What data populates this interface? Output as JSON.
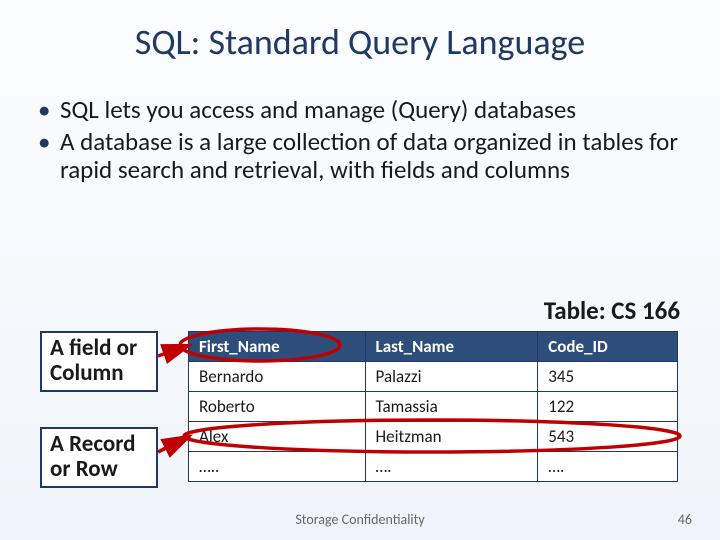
{
  "title": "SQL: Standard Query Language",
  "bullets": [
    "SQL lets you access and manage (Query) databases",
    "A database is a large collection of data organized in tables for rapid search and retrieval, with fields and columns"
  ],
  "table_label": "Table: CS 166",
  "column_box": "A field or Column",
  "row_box": "A Record or Row",
  "table": {
    "headers": [
      "First_Name",
      "Last_Name",
      "Code_ID"
    ],
    "rows": [
      [
        "Bernardo",
        "Palazzi",
        "345"
      ],
      [
        "Roberto",
        "Tamassia",
        "122"
      ],
      [
        "Alex",
        "Heitzman",
        "543"
      ],
      [
        "…..",
        "….",
        "…."
      ]
    ]
  },
  "footer": "Storage Confidentiality",
  "page_number": "46"
}
